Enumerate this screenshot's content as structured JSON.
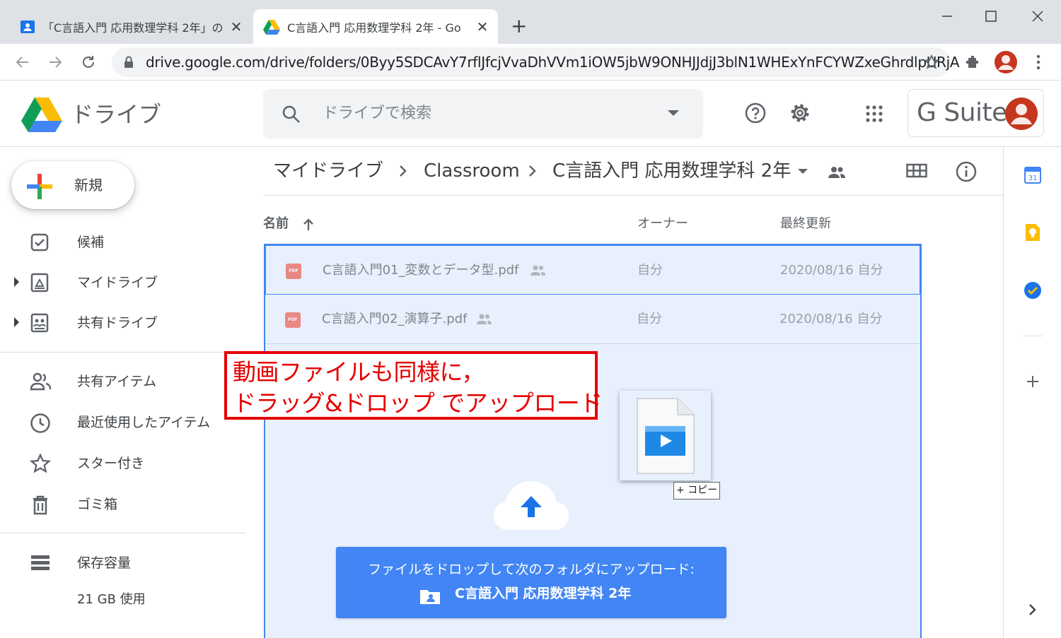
{
  "browser": {
    "tabs": [
      {
        "label": "「C言語入門 応用数理学科 2年」の",
        "icon": "classroom-icon",
        "active": false
      },
      {
        "label": "C言語入門 応用数理学科 2年 - Go",
        "icon": "google-drive-icon",
        "active": true
      }
    ],
    "url": "drive.google.com/drive/folders/0Byy5SDCAvY7rflJfcjVvaDhVVm1iOW5jbW9ONHJJdjJ3blN1WHExYnFCYWZxeGhrdlpURjA"
  },
  "drive": {
    "brand": "ドライブ",
    "search_placeholder": "ドライブで検索",
    "gsuite_label": "G Suite",
    "new_button": "新規",
    "nav": [
      {
        "label": "候補",
        "icon": "priority-check-icon"
      },
      {
        "label": "マイドライブ",
        "icon": "my-drive-icon"
      },
      {
        "label": "共有ドライブ",
        "icon": "shared-drives-icon"
      },
      {
        "label": "共有アイテム",
        "icon": "people-icon"
      },
      {
        "label": "最近使用したアイテム",
        "icon": "clock-icon"
      },
      {
        "label": "スター付き",
        "icon": "star-icon"
      },
      {
        "label": "ゴミ箱",
        "icon": "trash-icon"
      }
    ],
    "storage": {
      "label": "保存容量",
      "usage": "21 GB 使用"
    },
    "breadcrumb": [
      "マイドライブ",
      "Classroom",
      "C言語入門 応用数理学科 2年"
    ],
    "columns": {
      "name": "名前",
      "owner": "オーナー",
      "modified": "最終更新"
    },
    "files": [
      {
        "name": "C言語入門01_変数とデータ型.pdf",
        "owner": "自分",
        "modified": "2020/08/16 自分",
        "type": "PDF"
      },
      {
        "name": "C言語入門02_演算子.pdf",
        "owner": "自分",
        "modified": "2020/08/16 自分",
        "type": "PDF"
      }
    ],
    "drag": {
      "copy_badge": "+ コピー"
    },
    "upload": {
      "message": "ファイルをドロップして次のフォルダにアップロード:",
      "folder": "C言語入門 応用数理学科 2年"
    }
  },
  "annotation": {
    "line1": "動画ファイルも同様に，",
    "line2": "ドラッグ&ドロップ でアップロード"
  },
  "colors": {
    "accent_blue": "#4285f4",
    "drop_zone_bg": "#e8f0fe",
    "annotation_red": "#e60000",
    "avatar": "#c5371f"
  }
}
